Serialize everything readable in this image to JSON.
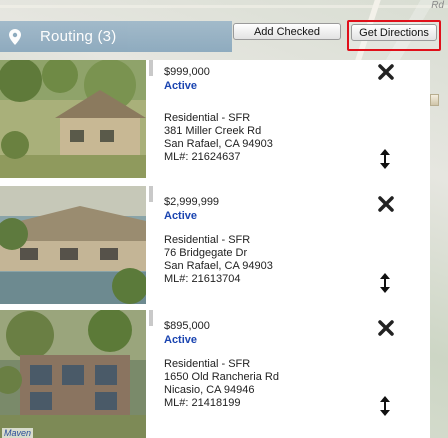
{
  "map": {
    "label_top": "Rd"
  },
  "routing": {
    "title": "Routing (3)",
    "icon": "map-pin-icon"
  },
  "buttons": {
    "add_checked": "Add Checked",
    "get_directions": "Get Directions"
  },
  "listings": [
    {
      "price": "$999,000",
      "status": "Active",
      "type": "Residential - SFR",
      "address": "381 Miller Creek Rd",
      "city": "San Rafael, CA 94903",
      "mls": "ML#:  21624637"
    },
    {
      "price": "$2,999,999",
      "status": "Active",
      "type": "Residential - SFR",
      "address": "76 Bridgegate Dr",
      "city": "San Rafael, CA 94903",
      "mls": "ML#:  21613704"
    },
    {
      "price": "$895,000",
      "status": "Active",
      "type": "Residential - SFR",
      "address": "1650 Old Rancheria Rd",
      "city": "Nicasio, CA 94946",
      "mls": "ML#:  21418199"
    }
  ],
  "footer": {
    "logo_text": "Maven"
  },
  "colors": {
    "accent_red": "#e0101a",
    "status_blue": "#1a44b0",
    "routing_bar": "#8aa8bd"
  }
}
